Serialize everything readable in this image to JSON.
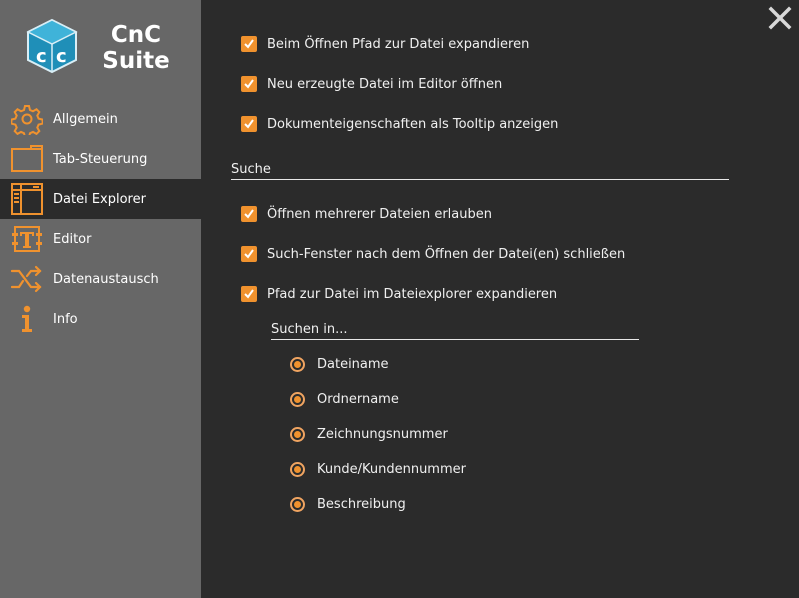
{
  "app": {
    "brand_line1": "CnC",
    "brand_line2": "Suite",
    "accent_color": "#f0922e"
  },
  "sidebar": {
    "items": [
      {
        "label": "Allgemein",
        "icon": "gear-icon",
        "active": false
      },
      {
        "label": "Tab-Steuerung",
        "icon": "tab-icon",
        "active": false
      },
      {
        "label": "Datei Explorer",
        "icon": "file-explorer-icon",
        "active": true
      },
      {
        "label": "Editor",
        "icon": "editor-icon",
        "active": false
      },
      {
        "label": "Datenaustausch",
        "icon": "shuffle-icon",
        "active": false
      },
      {
        "label": "Info",
        "icon": "info-icon",
        "active": false
      }
    ]
  },
  "options": {
    "general": [
      {
        "label": "Beim Öffnen Pfad zur Datei expandieren",
        "checked": true
      },
      {
        "label": "Neu erzeugte Datei im Editor öffnen",
        "checked": true
      },
      {
        "label": "Dokumenteigenschaften als Tooltip anzeigen",
        "checked": true
      }
    ],
    "search_title": "Suche",
    "search": [
      {
        "label": "Öffnen mehrerer Dateien erlauben",
        "checked": true
      },
      {
        "label": "Such-Fenster nach dem Öffnen der Datei(en) schließen",
        "checked": true
      },
      {
        "label": "Pfad zur Datei im Dateiexplorer expandieren",
        "checked": true
      }
    ],
    "search_in_title": "Suchen in...",
    "search_in": [
      {
        "label": "Dateiname",
        "selected": true
      },
      {
        "label": "Ordnername",
        "selected": true
      },
      {
        "label": "Zeichnungsnummer",
        "selected": true
      },
      {
        "label": "Kunde/Kundennummer",
        "selected": true
      },
      {
        "label": "Beschreibung",
        "selected": true
      }
    ]
  }
}
